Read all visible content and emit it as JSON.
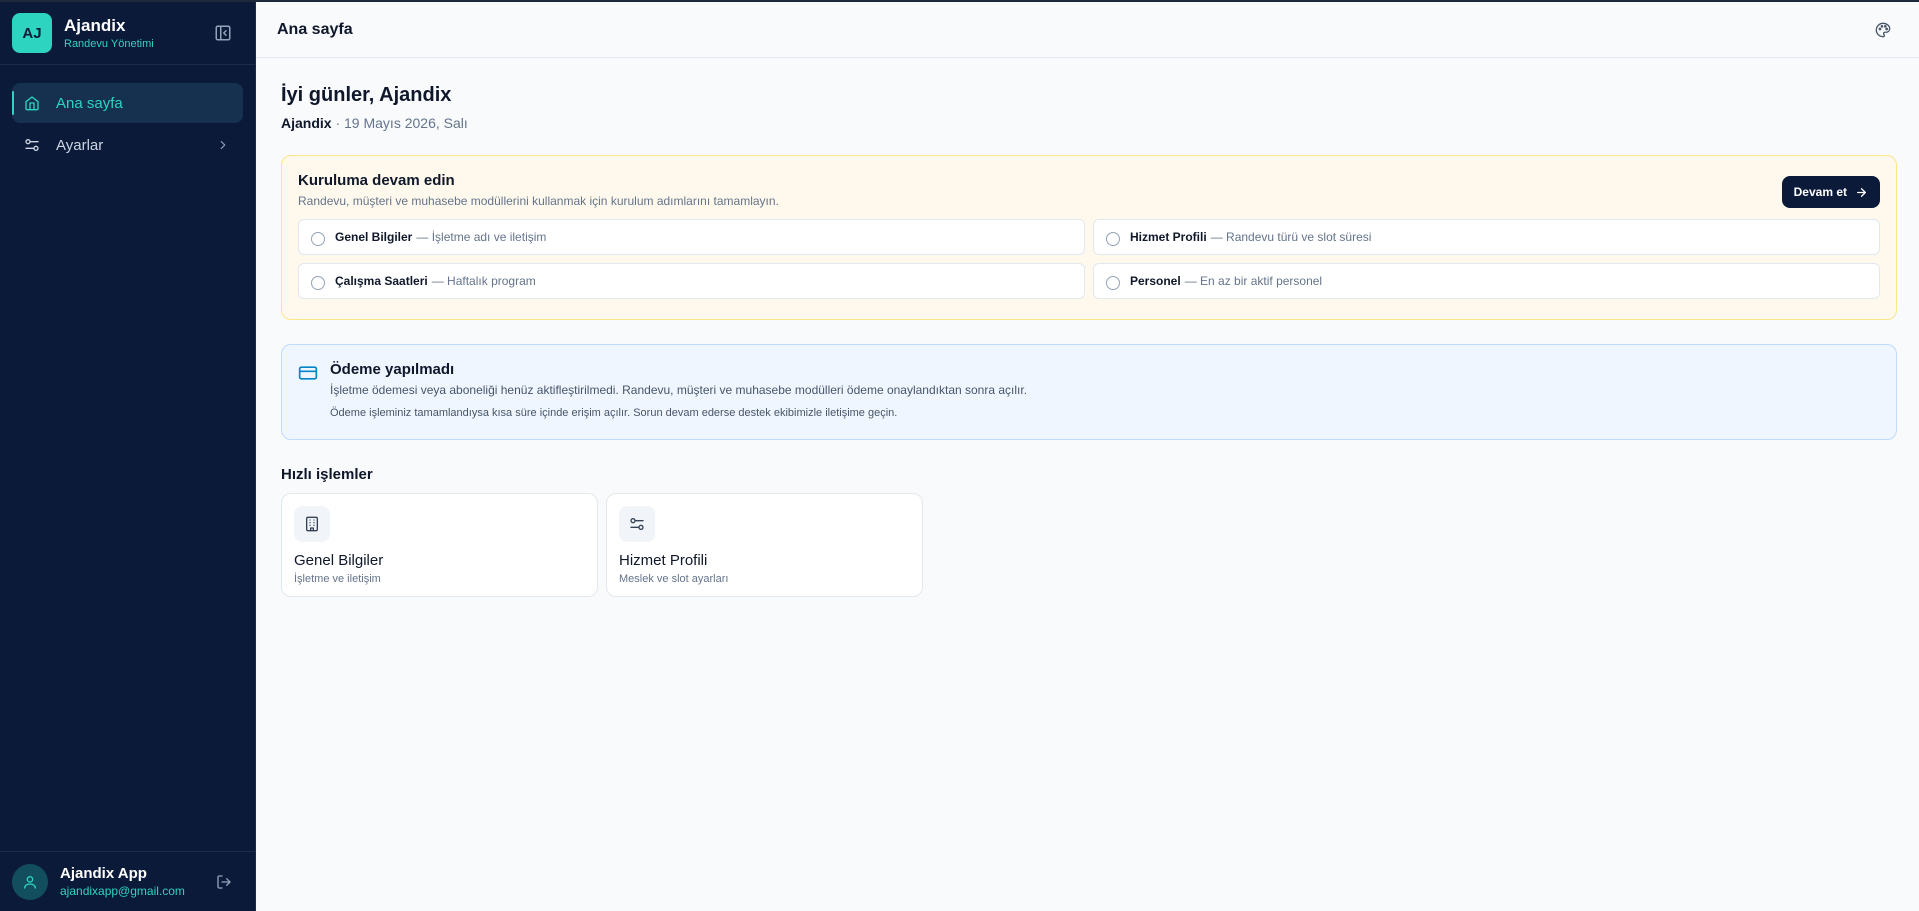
{
  "brand": {
    "initials": "AJ",
    "name": "Ajandix",
    "subtitle": "Randevu Yönetimi"
  },
  "sidebar": {
    "items": [
      {
        "label": "Ana sayfa",
        "icon": "home-icon",
        "active": true
      },
      {
        "label": "Ayarlar",
        "icon": "sliders-icon",
        "active": false
      }
    ]
  },
  "user": {
    "name": "Ajandix App",
    "email": "ajandixapp@gmail.com"
  },
  "header": {
    "title": "Ana sayfa"
  },
  "main": {
    "greeting": "İyi günler, Ajandix",
    "org": "Ajandix",
    "date_line": " · 19 Mayıs 2026, Salı"
  },
  "setup": {
    "title": "Kuruluma devam edin",
    "description": "Randevu, müşteri ve muhasebe modüllerini kullanmak için kurulum adımlarını tamamlayın.",
    "button_label": "Devam et",
    "steps": [
      {
        "name": "Genel Bilgiler",
        "desc": "— İşletme adı ve iletişim"
      },
      {
        "name": "Hizmet Profili",
        "desc": "— Randevu türü ve slot süresi"
      },
      {
        "name": "Çalışma Saatleri",
        "desc": "— Haftalık program"
      },
      {
        "name": "Personel",
        "desc": "— En az bir aktif personel"
      }
    ]
  },
  "payment": {
    "title": "Ödeme yapılmadı",
    "description": "İşletme ödemesi veya aboneliği henüz aktifleştirilmedi. Randevu, müşteri ve muhasebe modülleri ödeme onaylandıktan sonra açılır.",
    "note": "Ödeme işleminiz tamamlandıysa kısa süre içinde erişim açılır. Sorun devam ederse destek ekibimizle iletişime geçin."
  },
  "quick": {
    "title": "Hızlı işlemler",
    "items": [
      {
        "name": "Genel Bilgiler",
        "sub": "İşletme ve iletişim",
        "icon": "building-icon"
      },
      {
        "name": "Hizmet Profili",
        "sub": "Meslek ve slot ayarları",
        "icon": "sliders-icon"
      }
    ]
  },
  "colors": {
    "sidebar_bg": "#0c1a3a",
    "accent": "#2dd4bf",
    "setup_bg": "#fef9ec",
    "payment_bg": "#eff6ff"
  }
}
